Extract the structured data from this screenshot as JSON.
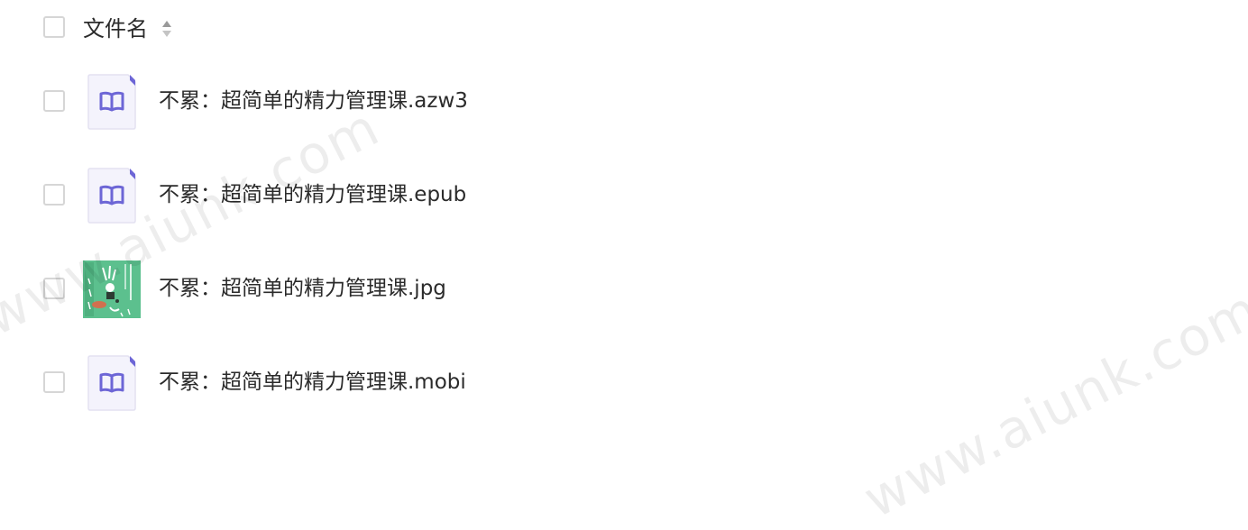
{
  "header": {
    "column_label": "文件名",
    "sort_icon": "sort-icon"
  },
  "files": [
    {
      "name": "不累：超简单的精力管理课.azw3",
      "icon": "book-icon"
    },
    {
      "name": "不累：超简单的精力管理课.epub",
      "icon": "book-icon"
    },
    {
      "name": "不累：超简单的精力管理课.jpg",
      "icon": "image-thumbnail"
    },
    {
      "name": "不累：超简单的精力管理课.mobi",
      "icon": "book-icon"
    }
  ],
  "watermark": "www.aiunk.com",
  "colors": {
    "icon_accent": "#7a73d9",
    "icon_bg": "#f4f3fc",
    "thumb_green": "#5cc08e"
  }
}
